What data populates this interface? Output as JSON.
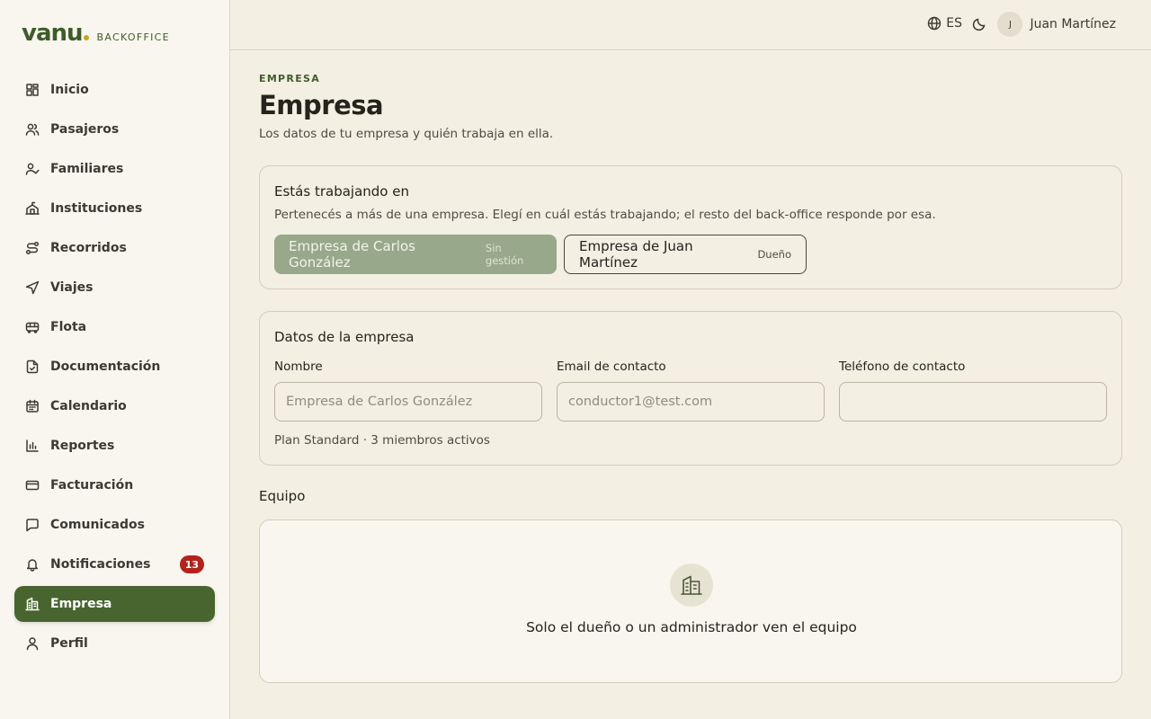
{
  "brand": {
    "logo": "vanu",
    "subtitle": "BACKOFFICE",
    "accent_color": "#c9a227"
  },
  "sidebar": {
    "items": [
      {
        "label": "Inicio",
        "icon": "dashboard-icon"
      },
      {
        "label": "Pasajeros",
        "icon": "users-icon"
      },
      {
        "label": "Familiares",
        "icon": "user-check-icon"
      },
      {
        "label": "Instituciones",
        "icon": "school-icon"
      },
      {
        "label": "Recorridos",
        "icon": "route-icon"
      },
      {
        "label": "Viajes",
        "icon": "navigation-icon"
      },
      {
        "label": "Flota",
        "icon": "bus-icon"
      },
      {
        "label": "Documentación",
        "icon": "file-check-icon"
      },
      {
        "label": "Calendario",
        "icon": "calendar-icon"
      },
      {
        "label": "Reportes",
        "icon": "bar-chart-icon"
      },
      {
        "label": "Facturación",
        "icon": "credit-card-icon"
      },
      {
        "label": "Comunicados",
        "icon": "message-icon"
      },
      {
        "label": "Notificaciones",
        "icon": "bell-icon",
        "badge": "13"
      },
      {
        "label": "Empresa",
        "icon": "building-icon",
        "active": true
      },
      {
        "label": "Perfil",
        "icon": "user-icon"
      }
    ],
    "active_color": "#48652f",
    "badge_color": "#b3221c"
  },
  "header": {
    "language": "ES",
    "user": {
      "initial": "J",
      "name": "Juan Martínez"
    }
  },
  "page": {
    "eyebrow": "EMPRESA",
    "title": "Empresa",
    "description": "Los datos de tu empresa y quién trabaja en ella."
  },
  "working_in": {
    "title": "Estás trabajando en",
    "description": "Pertenecés a más de una empresa. Elegí en cuál estás trabajando; el resto del back-office responde por esa.",
    "options": [
      {
        "name": "Empresa de Carlos González",
        "tag": "Sin gestión",
        "selected": true
      },
      {
        "name": "Empresa de Juan Martínez",
        "tag": "Dueño",
        "selected": false
      }
    ]
  },
  "company_data": {
    "title": "Datos de la empresa",
    "fields": [
      {
        "label": "Nombre",
        "value": "Empresa de Carlos González"
      },
      {
        "label": "Email de contacto",
        "value": "conductor1@test.com"
      },
      {
        "label": "Teléfono de contacto",
        "value": ""
      }
    ],
    "plan_info": "Plan Standard · 3 miembros activos"
  },
  "team": {
    "title": "Equipo",
    "empty_message": "Solo el dueño o un administrador ven el equipo"
  }
}
